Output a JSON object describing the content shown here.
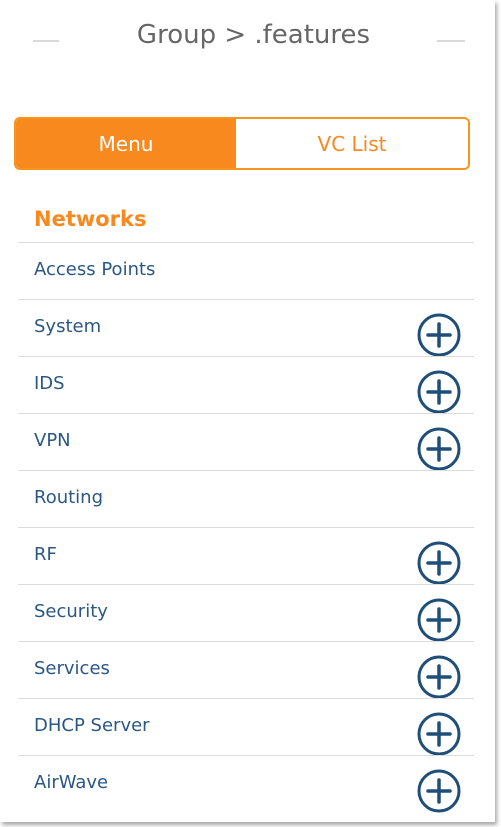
{
  "header": {
    "breadcrumb": "Group > .features"
  },
  "toggle": {
    "menu_label": "Menu",
    "vc_list_label": "VC List",
    "active": "Menu"
  },
  "colors": {
    "accent": "#f7891f",
    "link": "#2b5784",
    "expand_icon": "#1f4e79",
    "divider": "#dcdcdc"
  },
  "section": {
    "title": "Networks"
  },
  "items": [
    {
      "label": "Access Points",
      "expandable": false
    },
    {
      "label": "System",
      "expandable": true,
      "icon": "plus-circle-icon"
    },
    {
      "label": "IDS",
      "expandable": true,
      "icon": "plus-circle-icon"
    },
    {
      "label": "VPN",
      "expandable": true,
      "icon": "plus-circle-icon"
    },
    {
      "label": "Routing",
      "expandable": false
    },
    {
      "label": "RF",
      "expandable": true,
      "icon": "plus-circle-icon"
    },
    {
      "label": "Security",
      "expandable": true,
      "icon": "plus-circle-icon"
    },
    {
      "label": "Services",
      "expandable": true,
      "icon": "plus-circle-icon"
    },
    {
      "label": "DHCP Server",
      "expandable": true,
      "icon": "plus-circle-icon"
    },
    {
      "label": "AirWave",
      "expandable": true,
      "icon": "plus-circle-icon"
    }
  ]
}
